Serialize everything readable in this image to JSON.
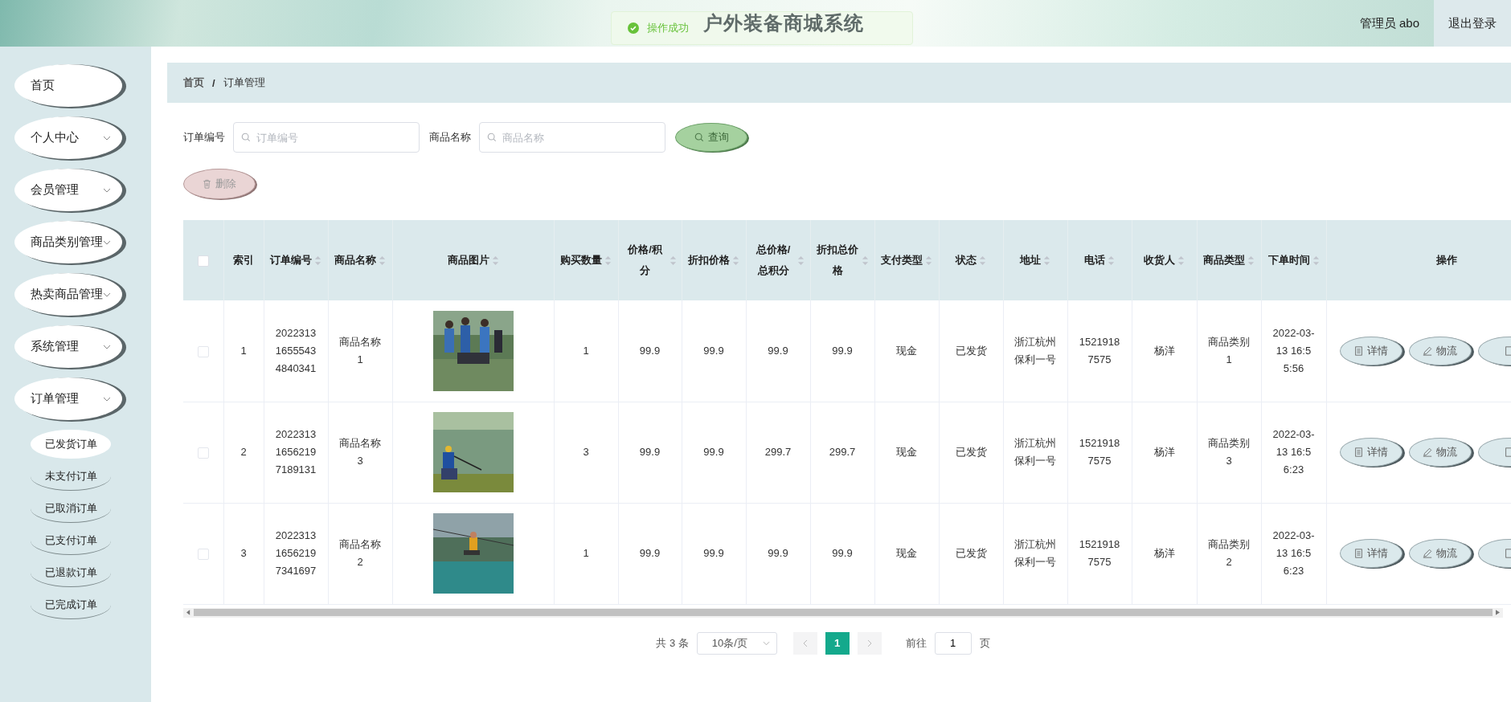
{
  "header": {
    "title": "户外装备商城系统",
    "user": "管理员 abo",
    "logout": "退出登录"
  },
  "toast": {
    "message": "操作成功"
  },
  "sidebar": {
    "items": [
      {
        "label": "首页",
        "kind": "link"
      },
      {
        "label": "个人中心",
        "kind": "submenu"
      },
      {
        "label": "会员管理",
        "kind": "submenu"
      },
      {
        "label": "商品类别管理",
        "kind": "submenu"
      },
      {
        "label": "热卖商品管理",
        "kind": "submenu"
      },
      {
        "label": "系统管理",
        "kind": "submenu"
      },
      {
        "label": "订单管理",
        "kind": "submenu",
        "children": [
          {
            "label": "已发货订单",
            "selected": true
          },
          {
            "label": "未支付订单",
            "selected": false
          },
          {
            "label": "已取消订单",
            "selected": false
          },
          {
            "label": "已支付订单",
            "selected": false
          },
          {
            "label": "已退款订单",
            "selected": false
          },
          {
            "label": "已完成订单",
            "selected": false
          }
        ]
      }
    ]
  },
  "breadcrumb": {
    "items": [
      "首页",
      "订单管理"
    ],
    "separator": "/"
  },
  "search": {
    "fields": [
      {
        "label": "订单编号",
        "placeholder": "订单编号"
      },
      {
        "label": "商品名称",
        "placeholder": "商品名称"
      }
    ],
    "button": "查询"
  },
  "delete_button": {
    "label": "删除",
    "disabled": true
  },
  "table": {
    "all_selected": false,
    "columns": [
      {
        "label": "索引",
        "sortable": false,
        "kind": "text"
      },
      {
        "label": "订单编号",
        "sortable": true,
        "kind": "text"
      },
      {
        "label": "商品名称",
        "sortable": true,
        "kind": "text"
      },
      {
        "label": "商品图片",
        "sortable": true,
        "kind": "picture"
      },
      {
        "label": "购买数量",
        "sortable": true,
        "kind": "text"
      },
      {
        "label": "价格/积分",
        "sortable": true,
        "kind": "text"
      },
      {
        "label": "折扣价格",
        "sortable": true,
        "kind": "text"
      },
      {
        "label": "总价格/总积分",
        "sortable": true,
        "kind": "text"
      },
      {
        "label": "折扣总价格",
        "sortable": true,
        "kind": "text"
      },
      {
        "label": "支付类型",
        "sortable": true,
        "kind": "text"
      },
      {
        "label": "状态",
        "sortable": true,
        "kind": "text"
      },
      {
        "label": "地址",
        "sortable": true,
        "kind": "text"
      },
      {
        "label": "电话",
        "sortable": true,
        "kind": "text"
      },
      {
        "label": "收货人",
        "sortable": true,
        "kind": "text"
      },
      {
        "label": "商品类型",
        "sortable": true,
        "kind": "text"
      },
      {
        "label": "下单时间",
        "sortable": true,
        "kind": "text"
      },
      {
        "label": "操作",
        "sortable": false,
        "kind": "actions"
      }
    ],
    "rows": [
      {
        "selected": false,
        "cells": [
          "1",
          "202231316555434840341",
          "商品名称1",
          {
            "kind": "picture"
          },
          "1",
          "99.9",
          "99.9",
          "99.9",
          "99.9",
          "现金",
          "已发货",
          "浙江杭州保利一号",
          "15219187575",
          "杨洋",
          "商品类别1",
          "2022-03-13 16:55:56",
          [
            "详情",
            "物流"
          ]
        ]
      },
      {
        "selected": false,
        "cells": [
          "2",
          "202231316562197189131",
          "商品名称3",
          {
            "kind": "picture"
          },
          "3",
          "99.9",
          "99.9",
          "299.7",
          "299.7",
          "现金",
          "已发货",
          "浙江杭州保利一号",
          "15219187575",
          "杨洋",
          "商品类别3",
          "2022-03-13 16:56:23",
          [
            "详情",
            "物流"
          ]
        ]
      },
      {
        "selected": false,
        "cells": [
          "3",
          "202231316562197341697",
          "商品名称2",
          {
            "kind": "picture"
          },
          "1",
          "99.9",
          "99.9",
          "99.9",
          "99.9",
          "现金",
          "已发货",
          "浙江杭州保利一号",
          "15219187575",
          "杨洋",
          "商品类别2",
          "2022-03-13 16:56:23",
          [
            "详情",
            "物流"
          ]
        ]
      }
    ]
  },
  "pagination": {
    "total": "共 3 条",
    "page_size": "10条/页",
    "pages": [
      {
        "label": "1",
        "selected": true
      }
    ],
    "goto_label": "前往",
    "goto_value": "1",
    "goto_suffix": "页"
  }
}
